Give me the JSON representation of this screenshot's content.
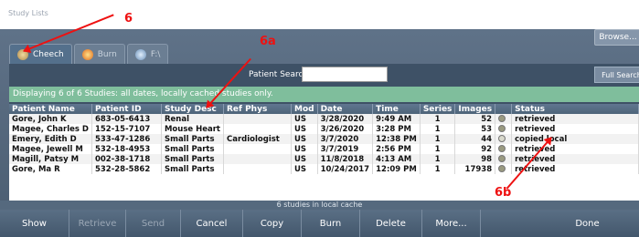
{
  "window": {
    "title": "Study Lists"
  },
  "tabs": [
    {
      "label": "Cheech",
      "icon": "person-icon",
      "active": true
    },
    {
      "label": "Burn",
      "icon": "disc-burn-icon",
      "active": false
    },
    {
      "label": "F:\\",
      "icon": "drive-icon",
      "active": false
    }
  ],
  "toolbar": {
    "browse_label": "Browse..."
  },
  "search": {
    "label": "Patient Search:",
    "value": "",
    "full_search_label": "Full Search"
  },
  "info": {
    "text": "Displaying 6 of 6 Studies: all dates, locally cached studies only."
  },
  "table": {
    "columns": [
      "Patient Name",
      "Patient ID",
      "Study Desc",
      "Ref Phys",
      "Mod",
      "Date",
      "Time",
      "Series",
      "Images",
      "",
      "Status"
    ],
    "rows": [
      [
        "Gore, John K",
        "683-05-6413",
        "Renal",
        "",
        "US",
        "3/28/2020",
        "9:49 AM",
        "1",
        "52",
        "",
        "retrieved"
      ],
      [
        "Magee, Charles D",
        "152-15-7107",
        "Mouse Heart",
        "",
        "US",
        "3/26/2020",
        "3:28 PM",
        "1",
        "53",
        "",
        "retrieved"
      ],
      [
        "Emery, Edith D",
        "533-47-1286",
        "Small Parts",
        "Cardiologist",
        "US",
        "3/7/2020",
        "12:38 PM",
        "1",
        "44",
        "",
        "copied local"
      ],
      [
        "Magee, Jewell M",
        "532-18-4953",
        "Small Parts",
        "",
        "US",
        "3/7/2019",
        "2:56 PM",
        "1",
        "92",
        "",
        "retrieved"
      ],
      [
        "Magill, Patsy M",
        "002-38-1718",
        "Small Parts",
        "",
        "US",
        "11/8/2018",
        "4:13 AM",
        "1",
        "98",
        "",
        "retrieved"
      ],
      [
        "Gore, Ma R",
        "532-28-5862",
        "Small Parts",
        "",
        "US",
        "10/24/2017",
        "12:09 PM",
        "1",
        "17938",
        "",
        "retrieved"
      ]
    ]
  },
  "footer": {
    "cache_text": "6 studies in local cache"
  },
  "buttons": {
    "show": "Show",
    "retrieve": "Retrieve",
    "send": "Send",
    "cancel": "Cancel",
    "copy": "Copy",
    "burn": "Burn",
    "delete": "Delete",
    "more": "More...",
    "done": "Done"
  },
  "annotations": {
    "a6": "6",
    "a6a": "6a",
    "a6b": "6b",
    "color": "#e11111"
  }
}
